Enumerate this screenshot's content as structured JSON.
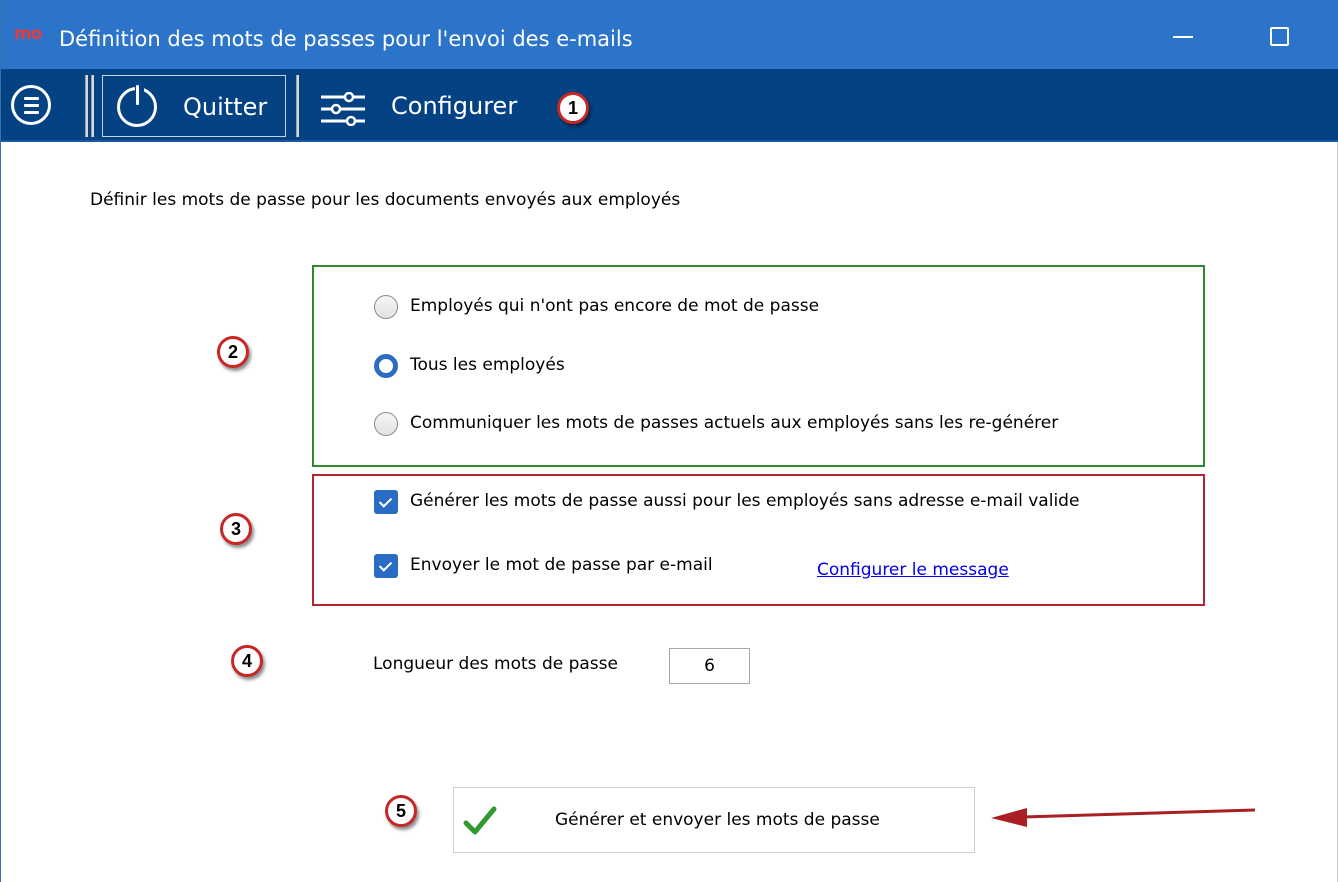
{
  "window": {
    "logo": "mo",
    "title": "Définition des mots de passes pour l'envoi des e-mails"
  },
  "toolbar": {
    "quit_label": "Quitter",
    "configure_label": "Configurer"
  },
  "badges": [
    "1",
    "2",
    "3",
    "4",
    "5"
  ],
  "main": {
    "intro": "Définir les mots de passe pour les documents envoyés aux employés",
    "recipients": {
      "options": [
        {
          "label": "Employés qui n'ont pas encore de mot de passe",
          "checked": false
        },
        {
          "label": "Tous les employés",
          "checked": true
        },
        {
          "label": "Communiquer les mots de passes actuels aux employés sans les re-générer",
          "checked": false
        }
      ]
    },
    "settings": {
      "generate_without_email": {
        "label": "Générer les mots de passe aussi pour les employés sans adresse e-mail valide",
        "checked": true
      },
      "send_by_email": {
        "label": "Envoyer le mot de passe par e-mail",
        "checked": true
      },
      "configure_message_link": "Configurer le message"
    },
    "length": {
      "label": "Longueur des mots de passe",
      "value": "6"
    },
    "generate_button": "Générer et envoyer les mots de passe"
  },
  "colors": {
    "titlebar": "#2b74c9",
    "toolbar": "#044284",
    "group_green": "#2f8a2f",
    "group_red": "#b3262e",
    "accent": "#2a6cc4",
    "link": "#0000ee"
  }
}
